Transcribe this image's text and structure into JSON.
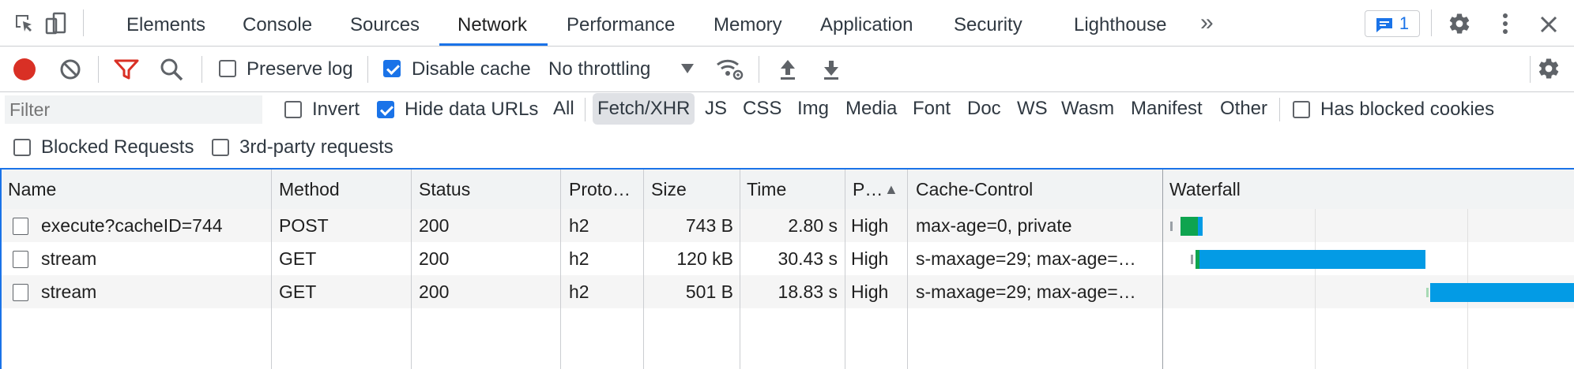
{
  "tabs": {
    "items": [
      "Elements",
      "Console",
      "Sources",
      "Network",
      "Performance",
      "Memory",
      "Application",
      "Security",
      "Lighthouse"
    ],
    "more": "»",
    "issues_count": "1"
  },
  "toolbar": {
    "preserve_log": "Preserve log",
    "disable_cache": "Disable cache",
    "throttling": "No throttling"
  },
  "filter": {
    "placeholder": "Filter",
    "invert": "Invert",
    "hide_data_urls": "Hide data URLs",
    "types": [
      "All",
      "Fetch/XHR",
      "JS",
      "CSS",
      "Img",
      "Media",
      "Font",
      "Doc",
      "WS",
      "Wasm",
      "Manifest",
      "Other"
    ],
    "selected_type": "Fetch/XHR",
    "has_blocked_cookies": "Has blocked cookies",
    "blocked_requests": "Blocked Requests",
    "third_party": "3rd-party requests"
  },
  "table": {
    "headers": {
      "name": "Name",
      "method": "Method",
      "status": "Status",
      "protocol": "Proto…",
      "size": "Size",
      "time": "Time",
      "priority": "P…",
      "cache_control": "Cache-Control",
      "waterfall": "Waterfall"
    },
    "sort_indicator": "▲",
    "rows": [
      {
        "name": "execute?cacheID=744",
        "method": "POST",
        "status": "200",
        "protocol": "h2",
        "size": "743 B",
        "time": "2.80 s",
        "priority": "High",
        "cache_control": "max-age=0, private"
      },
      {
        "name": "stream",
        "method": "GET",
        "status": "200",
        "protocol": "h2",
        "size": "120 kB",
        "time": "30.43 s",
        "priority": "High",
        "cache_control": "s-maxage=29; max-age=…"
      },
      {
        "name": "stream",
        "method": "GET",
        "status": "200",
        "protocol": "h2",
        "size": "501 B",
        "time": "18.83 s",
        "priority": "High",
        "cache_control": "s-maxage=29; max-age=…"
      }
    ]
  },
  "colors": {
    "record": "#d93025",
    "filter_icon": "#d93025",
    "accent": "#1a73e8",
    "waterfall_green": "#0ea44f",
    "waterfall_blue": "#039be5"
  }
}
